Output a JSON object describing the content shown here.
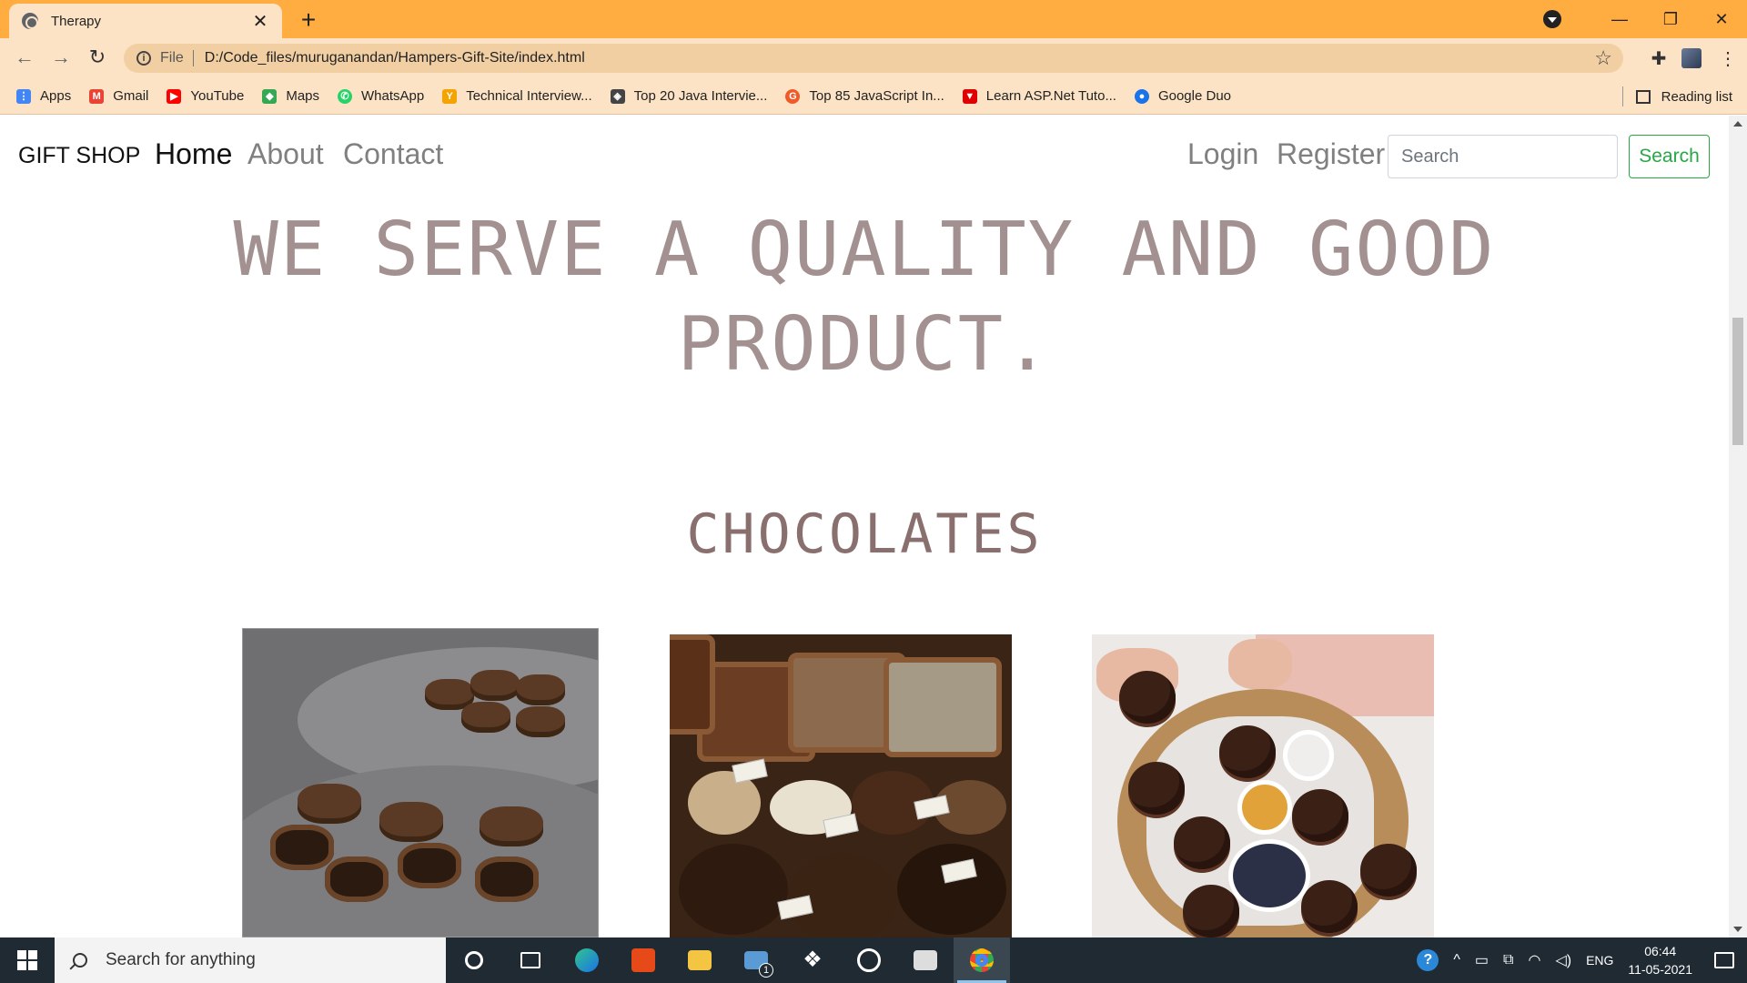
{
  "browser": {
    "tab_title": "Therapy",
    "tab_close": "✕",
    "new_tab": "+",
    "window_controls": {
      "minimize": "—",
      "maximize": "❐",
      "close": "✕"
    },
    "nav": {
      "back": "←",
      "forward": "→",
      "reload": "↻"
    },
    "address": {
      "scheme_label": "File",
      "url": "D:/Code_files/muruganandan/Hampers-Gift-Site/index.html"
    },
    "bookmarks": [
      {
        "label": "Apps",
        "icon": "apps-grid-icon",
        "color": "#4285f4"
      },
      {
        "label": "Gmail",
        "icon": "gmail-icon",
        "color": "#ea4335"
      },
      {
        "label": "YouTube",
        "icon": "youtube-icon",
        "color": "#ff0000"
      },
      {
        "label": "Maps",
        "icon": "maps-icon",
        "color": "#34a853"
      },
      {
        "label": "WhatsApp",
        "icon": "whatsapp-icon",
        "color": "#25d366"
      },
      {
        "label": "Technical Interview...",
        "icon": "technical-interview-icon",
        "color": "#f4a300"
      },
      {
        "label": "Top 20 Java Intervie...",
        "icon": "java-icon",
        "color": "#444444"
      },
      {
        "label": "Top 85 JavaScript In...",
        "icon": "javascript-icon",
        "color": "#f05a28"
      },
      {
        "label": "Learn ASP.Net Tuto...",
        "icon": "aspnet-icon",
        "color": "#e00000"
      },
      {
        "label": "Google Duo",
        "icon": "google-duo-icon",
        "color": "#1a73e8"
      }
    ],
    "reading_list": "Reading list"
  },
  "site": {
    "brand": "GIFT SHOP",
    "nav_links": {
      "home": "Home",
      "about": "About",
      "contact": "Contact"
    },
    "auth": {
      "login": "Login",
      "register": "Register"
    },
    "search": {
      "placeholder": "Search",
      "button": "Search"
    },
    "hero_line1": "WE SERVE A QUALITY AND GOOD",
    "hero_line2": "PRODUCT.",
    "section_title": "CHOCOLATES",
    "products": [
      {
        "name": "chocolate-bonbons-image"
      },
      {
        "name": "chocolate-market-image"
      },
      {
        "name": "chocolate-muffins-image"
      }
    ]
  },
  "taskbar": {
    "search_placeholder": "Search for anything",
    "mail_badge": "1",
    "language": "ENG",
    "time": "06:44",
    "date": "11-05-2021"
  },
  "colors": {
    "titlebar": "#ffac40",
    "toolbar": "#fde3c5",
    "hero_text": "#a39090",
    "section_text": "#8a6f6f",
    "search_button": "#28a745",
    "taskbar": "#1f2a33"
  }
}
